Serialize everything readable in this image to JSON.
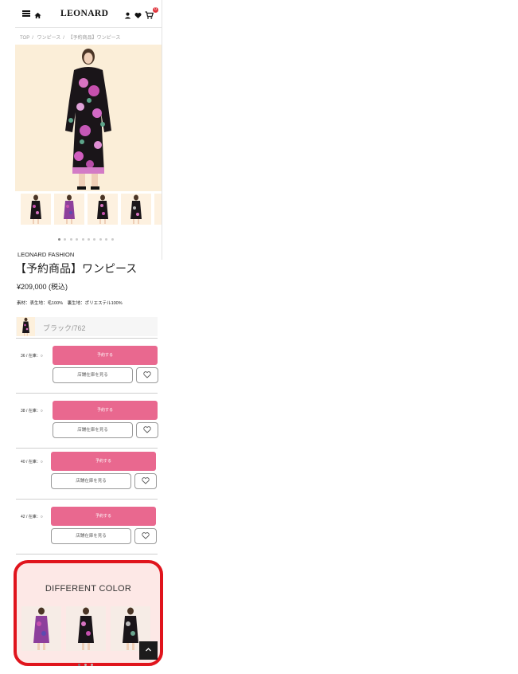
{
  "header": {
    "logo": "LEONARD",
    "icons": [
      "menu-icon",
      "home-icon",
      "user-icon",
      "heart-icon",
      "cart-icon"
    ],
    "cart_count": "0"
  },
  "breadcrumb": [
    "TOP",
    "ワンピース",
    "【予約商品】ワンピース"
  ],
  "gallery": {
    "thumb_count": 5,
    "dot_count": 10,
    "active_dot": 0
  },
  "product": {
    "brand": "LEONARD FASHION",
    "title": "【予約商品】ワンピース",
    "price": "¥209,000 (税込)",
    "material": "素材：表生地：毛100%　裏生地：ポリエステル100%"
  },
  "color": {
    "label": "ブラック/762"
  },
  "sizes": [
    {
      "label": "36 / 在庫：○",
      "reserve": "予約する",
      "store": "店舗在庫を見る"
    },
    {
      "label": "38 / 在庫：○",
      "reserve": "予約する",
      "store": "店舗在庫を見る"
    },
    {
      "label": "40 / 在庫：○",
      "reserve": "予約する",
      "store": "店舗在庫を見る"
    },
    {
      "label": "42 / 在庫：○",
      "reserve": "予約する",
      "store": "店舗在庫を見る"
    }
  ],
  "different_color": {
    "title": "DIFFERENT COLOR",
    "dot_count": 3,
    "active_dot": 0
  },
  "colors": {
    "accent_pink": "#e9688f",
    "highlight_red": "#e0141c",
    "section_bg": "#fde8e6"
  }
}
